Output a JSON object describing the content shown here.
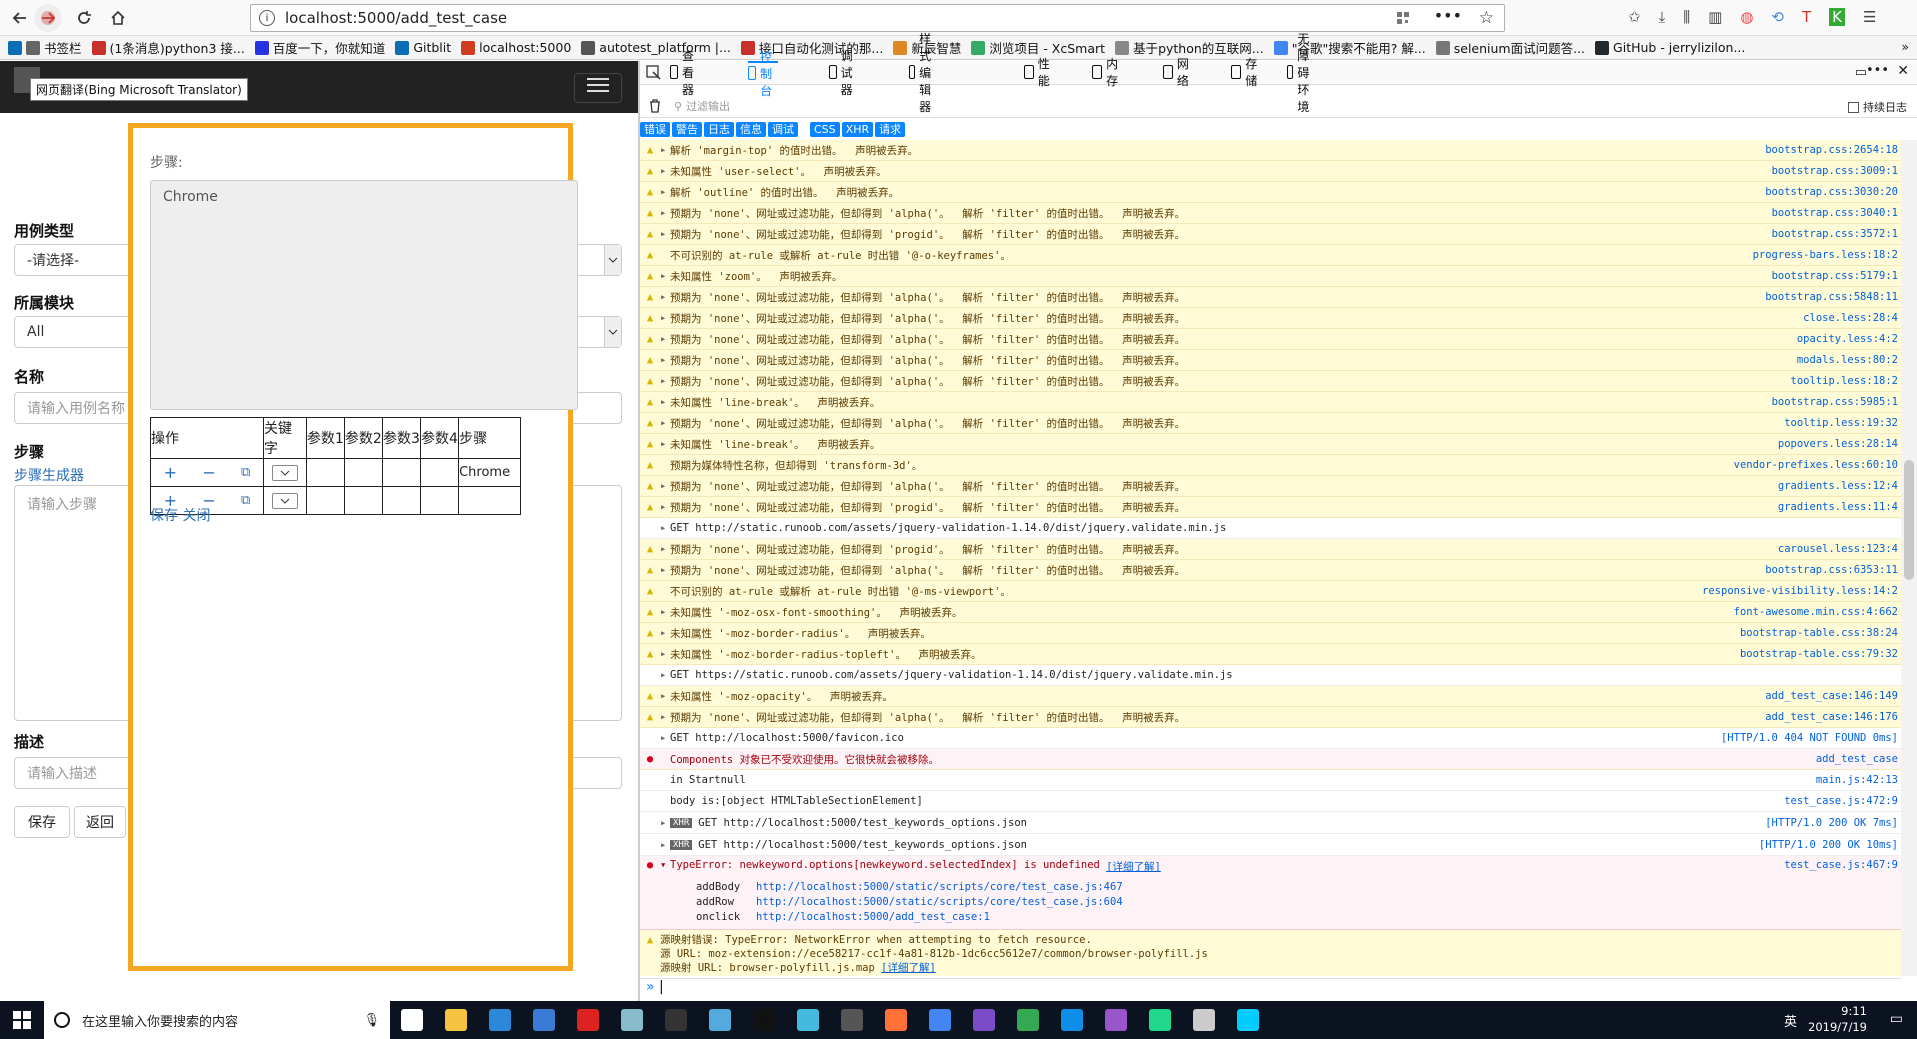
{
  "browser": {
    "url": "localhost:5000/add_test_case"
  },
  "bookmarks": [
    {
      "label": "书签栏",
      "color": "#666"
    },
    {
      "label": "(1条消息)python3 接...",
      "color": "#c9302c"
    },
    {
      "label": "百度一下，你就知道",
      "color": "#2932e1"
    },
    {
      "label": "Gitblit",
      "color": "#0a6db5"
    },
    {
      "label": "localhost:5000",
      "color": "#d03c1f"
    },
    {
      "label": "autotest_platform |...",
      "color": "#555"
    },
    {
      "label": "接口自动化测试的那...",
      "color": "#c9302c"
    },
    {
      "label": "新辰智慧",
      "color": "#d82"
    },
    {
      "label": "浏览项目 - XcSmart",
      "color": "#3a6"
    },
    {
      "label": "基于python的互联网...",
      "color": "#888"
    },
    {
      "label": "\"谷歌\"搜索不能用? 解...",
      "color": "#4285f4"
    },
    {
      "label": "selenium面试问题答...",
      "color": "#777"
    },
    {
      "label": "GitHub - jerrylizilon...",
      "color": "#24292e"
    }
  ],
  "translate_tooltip": "网页翻译(Bing Microsoft Translator)",
  "form": {
    "case_type_label": "用例类型",
    "case_type_value": "-请选择-",
    "module_label": "所属模块",
    "module_value": "All",
    "name_label": "名称",
    "name_placeholder": "请输入用例名称",
    "steps_label": "步骤",
    "steps_link": "步骤生成器",
    "steps_placeholder": "请输入步骤",
    "desc_label": "描述",
    "desc_placeholder": "请输入描述",
    "save": "保存",
    "back": "返回"
  },
  "modal": {
    "steps_label": "步骤:",
    "textarea_value": "Chrome",
    "headers": [
      "操作",
      "关键字",
      "参数1",
      "参数2",
      "参数3",
      "参数4",
      "步骤"
    ],
    "rows": [
      {
        "step": "Chrome"
      },
      {
        "step": ""
      }
    ],
    "save": "保存",
    "close": "关闭"
  },
  "devtools": {
    "tools": [
      "查看器",
      "控制台",
      "调试器",
      "样式编辑器",
      "性能",
      "内存",
      "网络",
      "存储",
      "无障碍环境"
    ],
    "filter_placeholder": "过滤输出",
    "persist": "持续日志",
    "filters": [
      "错误",
      "警告",
      "日志",
      "信息",
      "调试",
      "CSS",
      "XHR",
      "请求"
    ],
    "messages": [
      {
        "t": "warn",
        "m": "解析 'margin-top' 的值时出错。  声明被丢弃。",
        "s": "bootstrap.css:2654:18"
      },
      {
        "t": "warn",
        "m": "未知属性 'user-select'。  声明被丢弃。",
        "s": "bootstrap.css:3009:1"
      },
      {
        "t": "warn",
        "m": "解析 'outline' 的值时出错。  声明被丢弃。",
        "s": "bootstrap.css:3030:20"
      },
      {
        "t": "warn",
        "m": "预期为 'none'、网址或过滤功能，但却得到 'alpha('。  解析 'filter' 的值时出错。  声明被丢弃。",
        "s": "bootstrap.css:3040:1"
      },
      {
        "t": "warn",
        "m": "预期为 'none'、网址或过滤功能，但却得到 'progid'。  解析 'filter' 的值时出错。  声明被丢弃。",
        "s": "bootstrap.css:3572:1"
      },
      {
        "t": "warn",
        "m": "不可识别的 at-rule 或解析 at-rule 时出错 '@-o-keyframes'。",
        "s": "progress-bars.less:18:2",
        "noar": true
      },
      {
        "t": "warn",
        "m": "未知属性 'zoom'。  声明被丢弃。",
        "s": "bootstrap.css:5179:1"
      },
      {
        "t": "warn",
        "m": "预期为 'none'、网址或过滤功能，但却得到 'alpha('。  解析 'filter' 的值时出错。  声明被丢弃。",
        "s": "bootstrap.css:5848:11"
      },
      {
        "t": "warn",
        "m": "预期为 'none'、网址或过滤功能，但却得到 'alpha('。  解析 'filter' 的值时出错。  声明被丢弃。",
        "s": "close.less:28:4"
      },
      {
        "t": "warn",
        "m": "预期为 'none'、网址或过滤功能，但却得到 'alpha('。  解析 'filter' 的值时出错。  声明被丢弃。",
        "s": "opacity.less:4:2"
      },
      {
        "t": "warn",
        "m": "预期为 'none'、网址或过滤功能，但却得到 'alpha('。  解析 'filter' 的值时出错。  声明被丢弃。",
        "s": "modals.less:80:2"
      },
      {
        "t": "warn",
        "m": "预期为 'none'、网址或过滤功能，但却得到 'alpha('。  解析 'filter' 的值时出错。  声明被丢弃。",
        "s": "tooltip.less:18:2"
      },
      {
        "t": "warn",
        "m": "未知属性 'line-break'。  声明被丢弃。",
        "s": "bootstrap.css:5985:1"
      },
      {
        "t": "warn",
        "m": "预期为 'none'、网址或过滤功能，但却得到 'alpha('。  解析 'filter' 的值时出错。  声明被丢弃。",
        "s": "tooltip.less:19:32"
      },
      {
        "t": "warn",
        "m": "未知属性 'line-break'。  声明被丢弃。",
        "s": "popovers.less:28:14"
      },
      {
        "t": "warn",
        "m": "预期为媒体特性名称，但却得到 'transform-3d'。",
        "s": "vendor-prefixes.less:60:10",
        "noar": true
      },
      {
        "t": "warn",
        "m": "预期为 'none'、网址或过滤功能，但却得到 'alpha('。  解析 'filter' 的值时出错。  声明被丢弃。",
        "s": "gradients.less:12:4"
      },
      {
        "t": "warn",
        "m": "预期为 'none'、网址或过滤功能，但却得到 'progid'。  解析 'filter' 的值时出错。  声明被丢弃。",
        "s": "gradients.less:11:4"
      },
      {
        "t": "log",
        "m": "GET http://static.runoob.com/assets/jquery-validation-1.14.0/dist/jquery.validate.min.js",
        "s": ""
      },
      {
        "t": "warn",
        "m": "预期为 'none'、网址或过滤功能，但却得到 'progid'。  解析 'filter' 的值时出错。  声明被丢弃。",
        "s": "carousel.less:123:4"
      },
      {
        "t": "warn",
        "m": "预期为 'none'、网址或过滤功能，但却得到 'alpha('。  解析 'filter' 的值时出错。  声明被丢弃。",
        "s": "bootstrap.css:6353:11"
      },
      {
        "t": "warn",
        "m": "不可识别的 at-rule 或解析 at-rule 时出错 '@-ms-viewport'。",
        "s": "responsive-visibility.less:14:2",
        "noar": true
      },
      {
        "t": "warn",
        "m": "未知属性 '-moz-osx-font-smoothing'。  声明被丢弃。",
        "s": "font-awesome.min.css:4:662"
      },
      {
        "t": "warn",
        "m": "未知属性 '-moz-border-radius'。  声明被丢弃。",
        "s": "bootstrap-table.css:38:24"
      },
      {
        "t": "warn",
        "m": "未知属性 '-moz-border-radius-topleft'。  声明被丢弃。",
        "s": "bootstrap-table.css:79:32"
      },
      {
        "t": "log",
        "m": "GET https://static.runoob.com/assets/jquery-validation-1.14.0/dist/jquery.validate.min.js",
        "s": ""
      },
      {
        "t": "warn",
        "m": "未知属性 '-moz-opacity'。  声明被丢弃。",
        "s": "add_test_case:146:149"
      },
      {
        "t": "warn",
        "m": "预期为 'none'、网址或过滤功能，但却得到 'alpha('。  解析 'filter' 的值时出错。  声明被丢弃。",
        "s": "add_test_case:146:176"
      },
      {
        "t": "log",
        "m": "GET http://localhost:5000/favicon.ico",
        "s": "[HTTP/1.0 404 NOT FOUND 0ms]"
      },
      {
        "t": "err",
        "m": "Components 对象已不受欢迎使用。它很快就会被移除。",
        "s": "add_test_case",
        "noar": true
      },
      {
        "t": "log",
        "m": "in Startnull",
        "s": "main.js:42:13",
        "noar": true
      },
      {
        "t": "log",
        "m": "body is:[object HTMLTableSectionElement]",
        "s": "test_case.js:472:9",
        "noar": true
      },
      {
        "t": "log",
        "m": "GET http://localhost:5000/test_keywords_options.json",
        "s": "[HTTP/1.0 200 OK 7ms]",
        "xhr": true
      },
      {
        "t": "log",
        "m": "GET http://localhost:5000/test_keywords_options.json",
        "s": "[HTTP/1.0 200 OK 10ms]",
        "xhr": true
      }
    ],
    "error": {
      "msg": "TypeError: newkeyword.options[newkeyword.selectedIndex] is undefined",
      "learn": "[详细了解]",
      "src": "test_case.js:467:9",
      "trace": [
        {
          "fn": "addBody",
          "url": "http://localhost:5000/static/scripts/core/test_case.js:467"
        },
        {
          "fn": "addRow",
          "url": "http://localhost:5000/static/scripts/core/test_case.js:604"
        },
        {
          "fn": "onclick",
          "url": "http://localhost:5000/add_test_case:1"
        }
      ]
    },
    "sourcemap": {
      "line1": "源映射错误: TypeError: NetworkError when attempting to fetch resource.",
      "line2": "源 URL: moz-extension://ece58217-cc1f-4a81-812b-1dc6cc5612e7/common/browser-polyfill.js",
      "line3": "源映射 URL: browser-polyfill.js.map",
      "learn": "[详细了解]"
    }
  },
  "taskbar": {
    "search_placeholder": "在这里输入你要搜索的内容",
    "time": "9:11",
    "date": "2019/7/19",
    "ime": "英"
  }
}
